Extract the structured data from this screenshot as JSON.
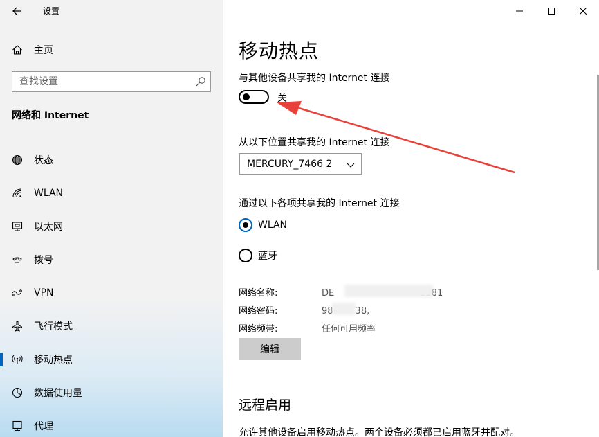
{
  "app": {
    "title": "设置"
  },
  "sidebar": {
    "home_label": "主页",
    "search_placeholder": "查找设置",
    "section_title": "网络和 Internet",
    "items": [
      {
        "label": "状态",
        "icon": "globe-icon"
      },
      {
        "label": "WLAN",
        "icon": "wifi-icon"
      },
      {
        "label": "以太网",
        "icon": "ethernet-icon"
      },
      {
        "label": "拨号",
        "icon": "dialup-icon"
      },
      {
        "label": "VPN",
        "icon": "vpn-icon"
      },
      {
        "label": "飞行模式",
        "icon": "airplane-icon"
      },
      {
        "label": "移动热点",
        "icon": "hotspot-icon",
        "active": true
      },
      {
        "label": "数据使用量",
        "icon": "data-usage-icon"
      },
      {
        "label": "代理",
        "icon": "proxy-icon"
      }
    ]
  },
  "main": {
    "page_title": "移动热点",
    "share_label": "与其他设备共享我的 Internet 连接",
    "toggle_state": "关",
    "toggle_on": false,
    "from_label": "从以下位置共享我的 Internet 连接",
    "from_selected": "MERCURY_7466 2",
    "via_label": "通过以下各项共享我的 Internet 连接",
    "radio_options": [
      {
        "label": "WLAN",
        "checked": true
      },
      {
        "label": "蓝牙",
        "checked": false
      }
    ],
    "info": [
      {
        "key": "网络名称:",
        "value_prefix": "DE",
        "value_suffix": "3381"
      },
      {
        "key": "网络密码:",
        "value_prefix": "98",
        "value_suffix": "38,"
      },
      {
        "key": "网络频带:",
        "value_prefix": "任何可用频率",
        "value_suffix": ""
      }
    ],
    "edit_label": "编辑",
    "remote_title": "远程启用",
    "remote_desc": "允许其他设备启用移动热点。两个设备必须都已启用蓝牙并配对。"
  },
  "colors": {
    "accent": "#0067c0",
    "annotation_arrow": "#e8413a",
    "sidebar_bg": "#f2f2f2"
  }
}
